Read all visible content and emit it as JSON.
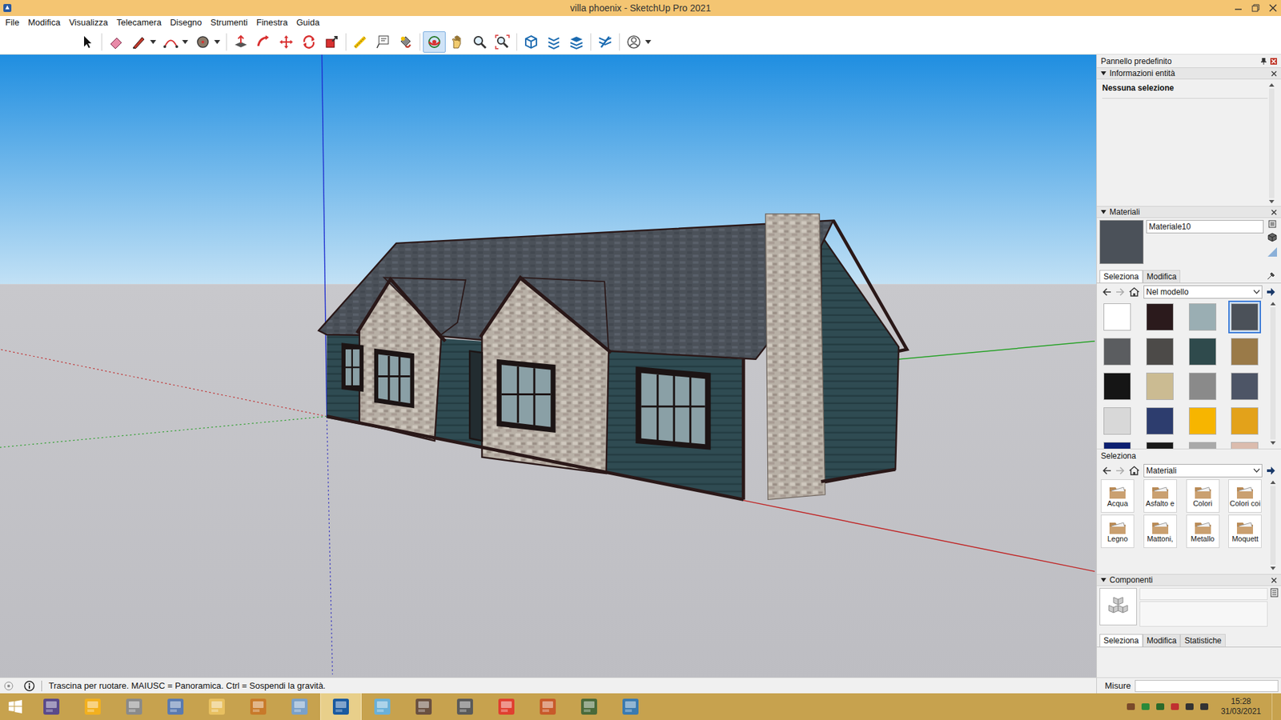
{
  "window": {
    "title": "villa phoenix - SketchUp Pro 2021"
  },
  "menu": [
    "File",
    "Modifica",
    "Visualizza",
    "Telecamera",
    "Disegno",
    "Strumenti",
    "Finestra",
    "Guida"
  ],
  "toolbar": [
    [
      {
        "kind": "button",
        "selected": false
      }
    ],
    [
      {
        "kind": "button",
        "selected": false
      },
      {
        "kind": "split",
        "selected": false
      },
      {
        "kind": "split",
        "selected": false
      },
      {
        "kind": "split",
        "selected": false
      }
    ],
    [
      {
        "kind": "button",
        "selected": false
      },
      {
        "kind": "button",
        "selected": false
      },
      {
        "kind": "button",
        "selected": false
      },
      {
        "kind": "button",
        "selected": false
      },
      {
        "kind": "button",
        "selected": false
      }
    ],
    [
      {
        "kind": "button",
        "selected": false
      },
      {
        "kind": "button",
        "selected": false
      },
      {
        "kind": "button",
        "selected": false
      }
    ],
    [
      {
        "kind": "button",
        "selected": true
      },
      {
        "kind": "button",
        "selected": false
      },
      {
        "kind": "button",
        "selected": false
      },
      {
        "kind": "button",
        "selected": false
      }
    ],
    [
      {
        "kind": "button",
        "selected": false
      },
      {
        "kind": "button",
        "selected": false
      },
      {
        "kind": "button",
        "selected": false
      }
    ],
    [
      {
        "kind": "button",
        "selected": false
      }
    ],
    [
      {
        "kind": "split",
        "selected": false
      }
    ]
  ],
  "panel": {
    "title": "Pannello predefinito",
    "entity_info": {
      "title": "Informazioni entità",
      "expanded": true,
      "text": "Nessuna selezione"
    },
    "materials": {
      "title": "Materiali",
      "expanded": true,
      "name": "Materiale10",
      "preview_color": "#4b5159",
      "tabs": [
        {
          "label": "Seleziona",
          "selected": true
        },
        {
          "label": "Modifica",
          "selected": false
        }
      ],
      "collection": "Nel modello",
      "swatches": [
        {
          "color": "#ffffff",
          "selected": false
        },
        {
          "color": "#2b1a1c",
          "selected": false
        },
        {
          "color": "#9aaeb3",
          "selected": false
        },
        {
          "color": "#4b5159",
          "selected": true
        },
        {
          "color": "#5b5d60",
          "selected": false
        },
        {
          "color": "#4c4a48",
          "selected": false
        },
        {
          "color": "#2f4a4c",
          "selected": false
        },
        {
          "color": "#9a7a48",
          "selected": false
        },
        {
          "color": "#151515",
          "selected": false
        },
        {
          "color": "#cbbb92",
          "selected": false
        },
        {
          "color": "#8a8a8a",
          "selected": false
        },
        {
          "color": "#4d5566",
          "selected": false
        },
        {
          "color": "#d8d8d8",
          "selected": false
        },
        {
          "color": "#2d3d6e",
          "selected": false
        },
        {
          "color": "#f7b500",
          "selected": false
        },
        {
          "color": "#e3a21a",
          "selected": false
        },
        {
          "color": "#0c1f70",
          "selected": false
        },
        {
          "color": "#1a1a1a",
          "selected": false
        },
        {
          "color": "#a9a9a9",
          "selected": false
        },
        {
          "color": "#dbbcae",
          "selected": false
        }
      ],
      "secondary_label": "Seleziona",
      "library": "Materiali",
      "folders": [
        "Acqua",
        "Asfalto e",
        "Colori",
        "Colori coi",
        "Legno",
        "Mattoni,",
        "Metallo",
        "Moquett"
      ]
    },
    "components": {
      "title": "Componenti",
      "expanded": true,
      "tabs": [
        {
          "label": "Seleziona",
          "selected": true
        },
        {
          "label": "Modifica",
          "selected": false
        },
        {
          "label": "Statistiche",
          "selected": false
        }
      ]
    }
  },
  "status_bar": {
    "hint": "Trascina per ruotare. MAIUSC = Panoramica. Ctrl = Sospendi la gravità.",
    "measure_label": "Misure"
  },
  "taskbar": {
    "apps": [
      {
        "active": false
      },
      {
        "active": false
      },
      {
        "active": false
      },
      {
        "active": false
      },
      {
        "active": false
      },
      {
        "active": false
      },
      {
        "active": false
      },
      {
        "active": true
      },
      {
        "active": false
      },
      {
        "active": false
      },
      {
        "active": false
      },
      {
        "active": false
      },
      {
        "active": false
      },
      {
        "active": false
      },
      {
        "active": false
      }
    ],
    "time": "15:28",
    "date": "31/03/2021"
  }
}
